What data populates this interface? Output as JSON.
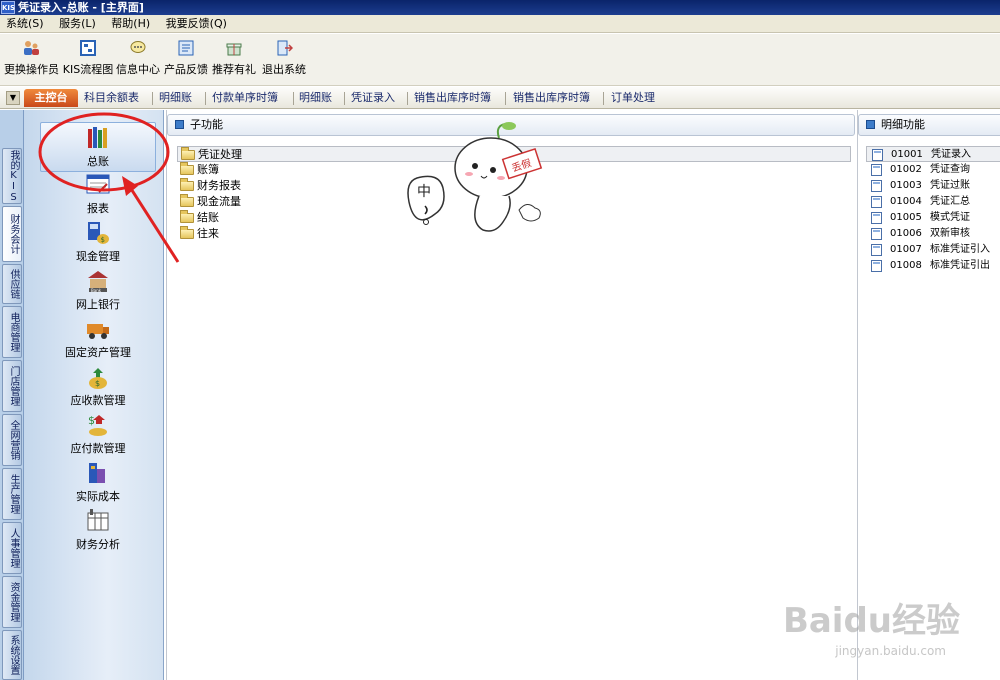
{
  "titlebar": {
    "app_icon": "KIS",
    "title": "凭证录入-总账 - [主界面]"
  },
  "menu": [
    "系统(S)",
    "服务(L)",
    "帮助(H)",
    "我要反馈(Q)"
  ],
  "toolbar": [
    {
      "icon": "change-operator-icon",
      "label": "更换操作员"
    },
    {
      "icon": "kis-flow-icon",
      "label": "KIS流程图"
    },
    {
      "icon": "message-center-icon",
      "label": "信息中心"
    },
    {
      "icon": "feedback-icon",
      "label": "产品反馈"
    },
    {
      "icon": "gift-icon",
      "label": "推荐有礼"
    },
    {
      "icon": "exit-icon",
      "label": "退出系统"
    }
  ],
  "tabs": {
    "main": "主控台",
    "items": [
      "科目余额表",
      "明细账",
      "付款单序时簿",
      "明细账",
      "凭证录入",
      "销售出库序时簿",
      "销售出库序时簿",
      "订单处理"
    ]
  },
  "vtabs": [
    "我的KIS",
    "财务会计",
    "供应链",
    "电商管理",
    "门店管理",
    "全网营销",
    "生产管理",
    "人事管理",
    "资金管理",
    "系统设置"
  ],
  "modules": [
    {
      "icon": "ledger-icon",
      "label": "总账"
    },
    {
      "icon": "report-icon",
      "label": "报表"
    },
    {
      "icon": "cash-icon",
      "label": "现金管理"
    },
    {
      "icon": "bank-icon",
      "label": "网上银行"
    },
    {
      "icon": "fixed-asset-icon",
      "label": "固定资产管理"
    },
    {
      "icon": "receivable-icon",
      "label": "应收款管理"
    },
    {
      "icon": "payable-icon",
      "label": "应付款管理"
    },
    {
      "icon": "cost-icon",
      "label": "实际成本"
    },
    {
      "icon": "analysis-icon",
      "label": "财务分析"
    }
  ],
  "subfunc": {
    "header": "子功能",
    "nodes": [
      "凭证处理",
      "账簿",
      "财务报表",
      "现金流量",
      "结账",
      "往来"
    ]
  },
  "detail": {
    "header": "明细功能",
    "items": [
      {
        "code": "01001",
        "name": "凭证录入"
      },
      {
        "code": "01002",
        "name": "凭证查询"
      },
      {
        "code": "01003",
        "name": "凭证过账"
      },
      {
        "code": "01004",
        "name": "凭证汇总"
      },
      {
        "code": "01005",
        "name": "模式凭证"
      },
      {
        "code": "01006",
        "name": "双新审核"
      },
      {
        "code": "01007",
        "name": "标准凭证引入"
      },
      {
        "code": "01008",
        "name": "标准凭证引出"
      }
    ]
  },
  "sticker": {
    "bubble": "中",
    "tag": "丢假"
  },
  "watermark": {
    "brand": "Baidu经验",
    "url": "jingyan.baidu.com"
  }
}
